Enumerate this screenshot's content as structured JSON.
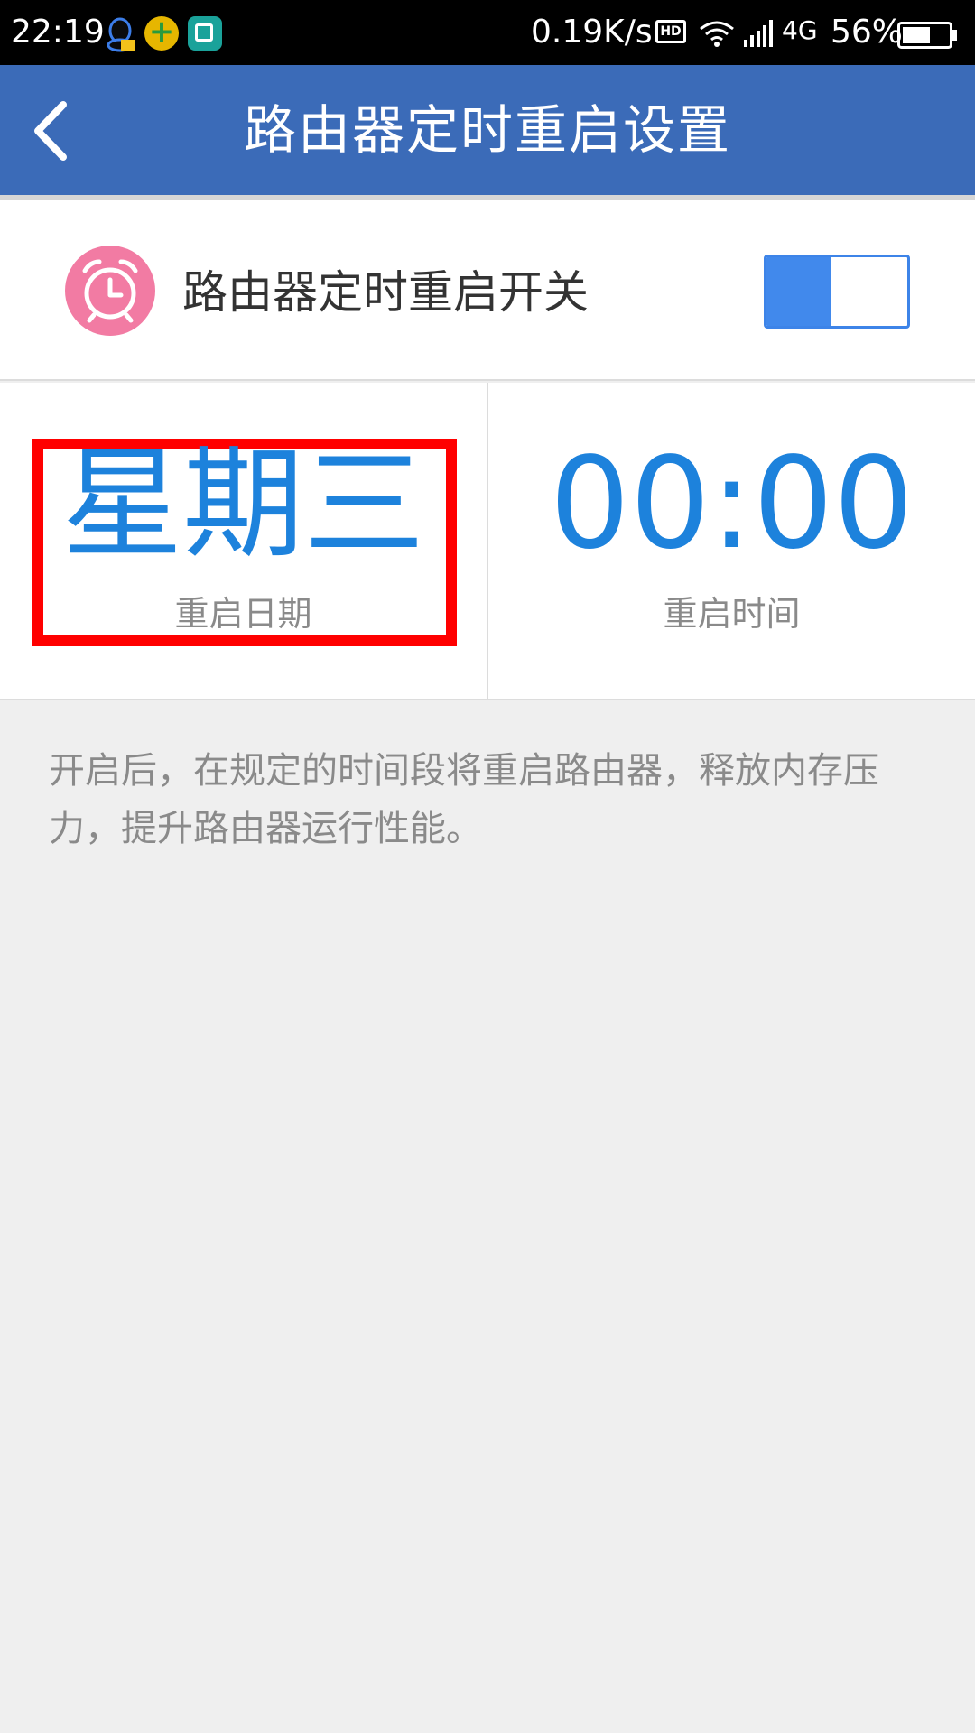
{
  "status_bar": {
    "time": "22:19",
    "speed": "0.19K/s",
    "hd_label": "HD",
    "network": "4G",
    "battery": "56%"
  },
  "header": {
    "title": "路由器定时重启设置"
  },
  "switch_row": {
    "label": "路由器定时重启开关",
    "enabled": true
  },
  "schedule": {
    "date_value": "星期三",
    "date_label": "重启日期",
    "time_value": "00:00",
    "time_label": "重启时间"
  },
  "description": "开启后，在规定的时间段将重启路由器，释放内存压力，提升路由器运行性能。",
  "colors": {
    "header_bg": "#3b6bb8",
    "accent_blue": "#1d82dc",
    "toggle_blue": "#4189ec",
    "alarm_pink": "#f27ba3",
    "highlight_red": "#ff0000"
  }
}
